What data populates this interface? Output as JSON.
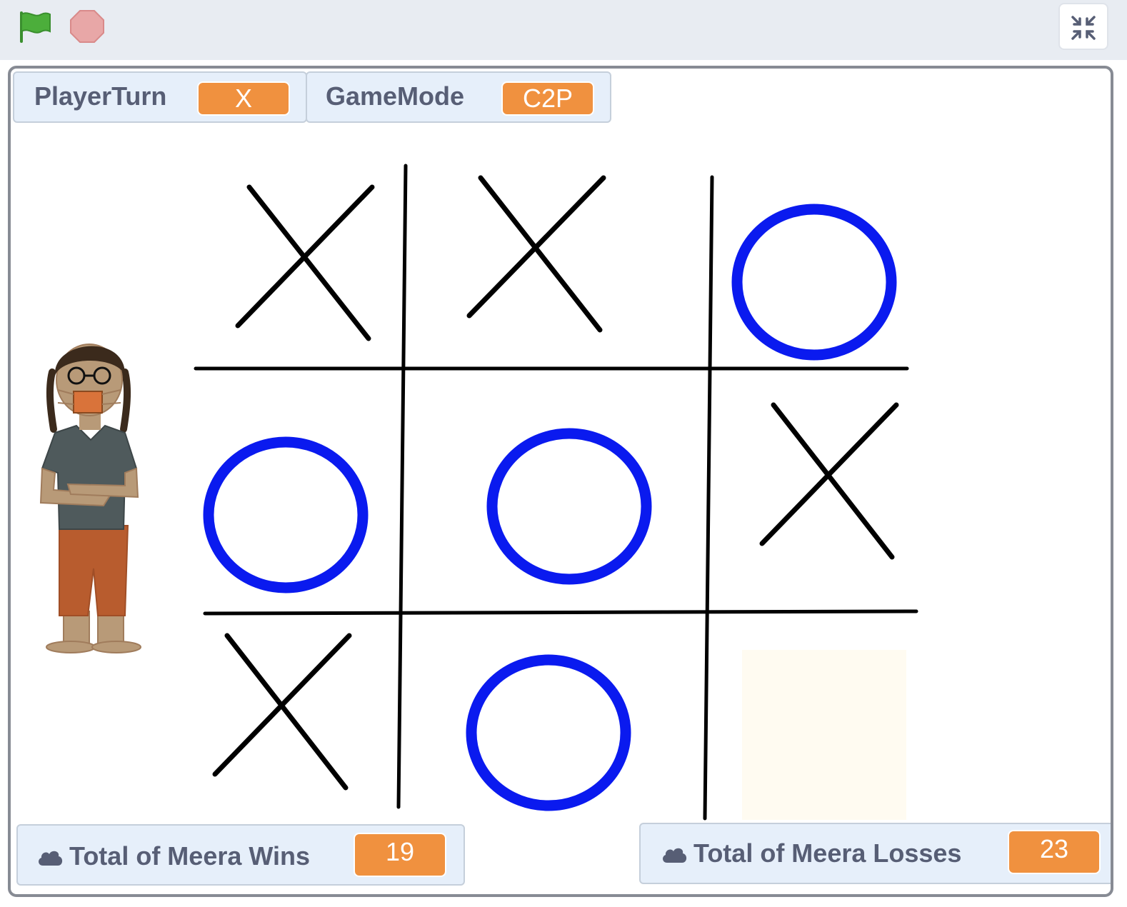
{
  "toolbar": {
    "green_flag_icon": "green-flag-icon",
    "stop_icon": "stop-sign-icon",
    "exit_fullscreen_icon": "shrink-icon"
  },
  "monitors": {
    "player_turn": {
      "label": "PlayerTurn",
      "value": "X"
    },
    "game_mode": {
      "label": "GameMode",
      "value": "C2P"
    },
    "wins": {
      "label": "Total of Meera Wins",
      "value": "19"
    },
    "losses": {
      "label": "Total of Meera Losses",
      "value": "23"
    }
  },
  "board": {
    "cells": [
      "X",
      "X",
      "O",
      "O",
      "O",
      "X",
      "X",
      "O",
      ""
    ]
  },
  "colors": {
    "accent_orange": "#f0913f",
    "o_blue": "#0a1aef",
    "x_black": "#000000",
    "monitor_bg": "#e6effa",
    "label_gray": "#575e75",
    "flag_green": "#4cae3b",
    "stop_red": "#e8a7a7"
  }
}
